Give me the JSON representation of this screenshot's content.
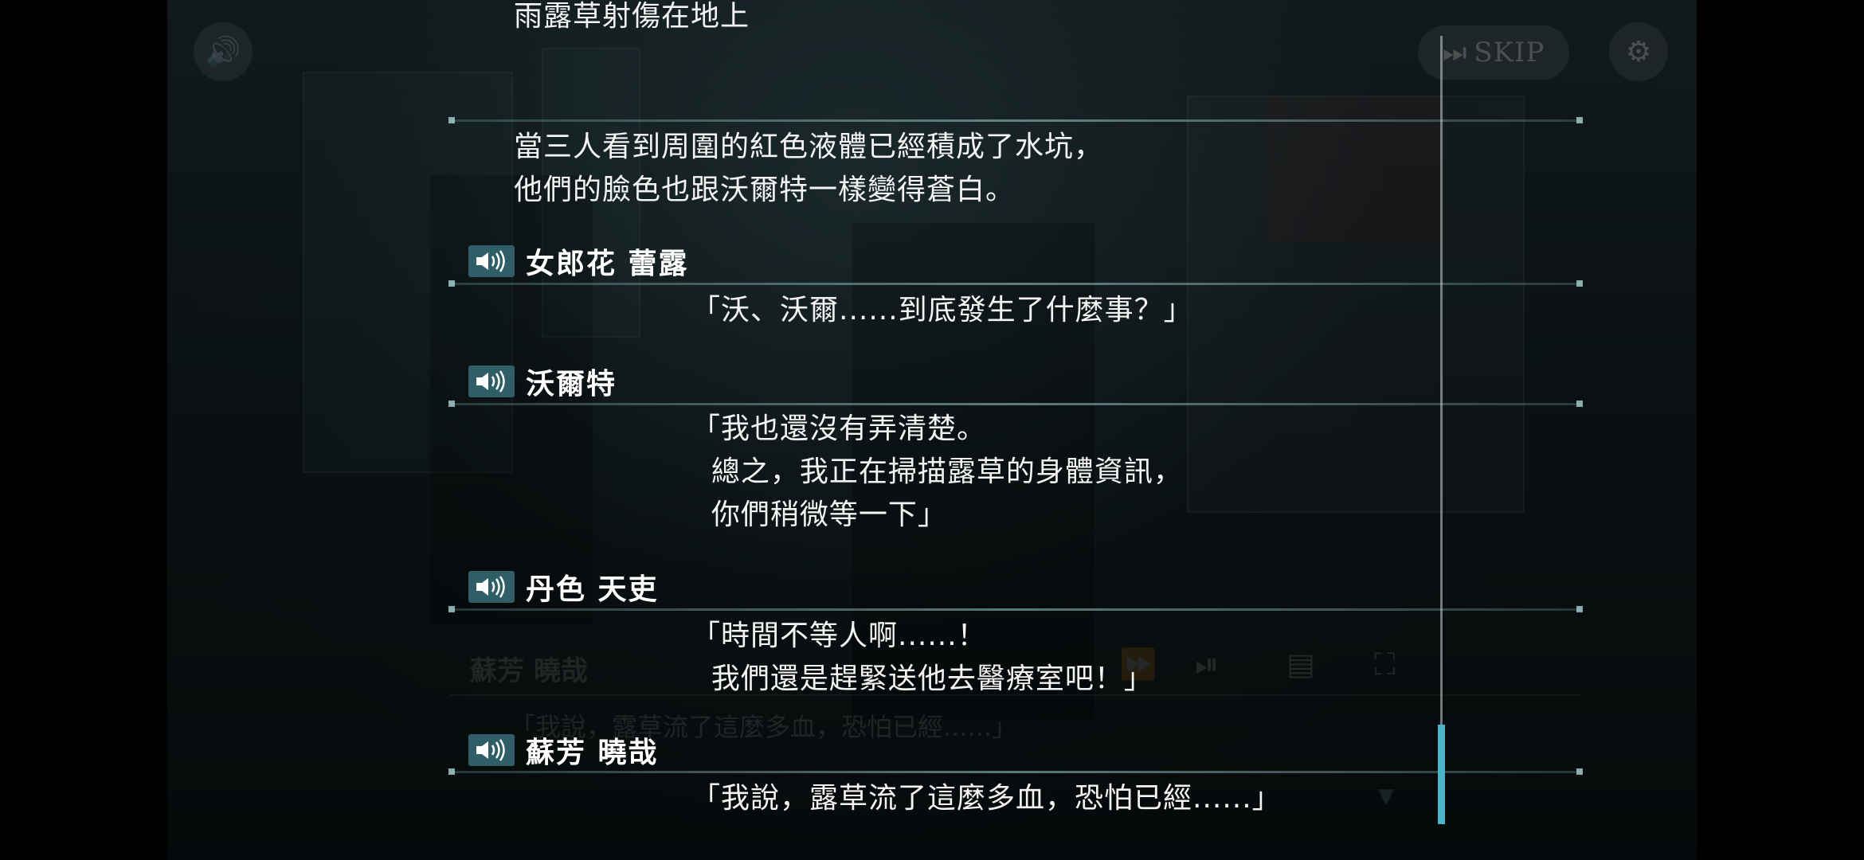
{
  "top_controls": {
    "skip_label": "SKIP"
  },
  "background_textbox": {
    "speaker": "蘇芳 曉哉",
    "line": "「我說，露草流了這麼多血，恐怕已經......」"
  },
  "backlog": {
    "partial_top_line": "雨露草射傷在地上",
    "entries": [
      {
        "speaker": "",
        "lines": [
          "當三人看到周圍的紅色液體已經積成了水坑，",
          "他們的臉色也跟沃爾特一樣變得蒼白。"
        ]
      },
      {
        "speaker": "女郎花 蕾露",
        "lines": [
          "「沃、沃爾......到底發生了什麼事？」"
        ]
      },
      {
        "speaker": "沃爾特",
        "lines": [
          "「我也還沒有弄清楚。",
          "  總之，我正在掃描露草的身體資訊，",
          "  你們稍微等一下」"
        ]
      },
      {
        "speaker": "丹色 天吏",
        "lines": [
          "「時間不等人啊......！",
          "  我們還是趕緊送他去醫療室吧！」"
        ]
      },
      {
        "speaker": "蘇芳 曉哉",
        "lines": [
          "「我說，露草流了這麼多血，恐怕已經......」"
        ]
      }
    ]
  },
  "colors": {
    "accent": "#49b7c7",
    "voice_button": "#2f5e66"
  }
}
